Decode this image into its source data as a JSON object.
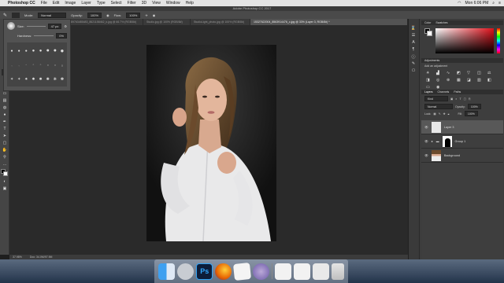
{
  "menubar": {
    "app_name": "Photoshop CC",
    "items": [
      "File",
      "Edit",
      "Image",
      "Layer",
      "Type",
      "Select",
      "Filter",
      "3D",
      "View",
      "Window",
      "Help"
    ],
    "clock": "Mon 6:06 PM"
  },
  "titlebar": {
    "title": "Adobe Photoshop CC 2017"
  },
  "options": {
    "mode_label": "Mode:",
    "mode_value": "Normal",
    "opacity_label": "Opacity:",
    "opacity_value": "100%",
    "flow_label": "Flow:",
    "flow_value": "100%"
  },
  "tabs": [
    {
      "label": "RGB/8#)"
    },
    {
      "label": "89763485483_8621158462_k.jpg @ 66.7% (RGB/8#)"
    },
    {
      "label": "Studio.jpg @ 100% (RGB/8#)"
    },
    {
      "label": "StudioLight_photo.jpg @ 100% (RGB/8#)"
    },
    {
      "label": "15327622004_8563914476_o.jpg @ 33% (Layer 3, RGB/8#) *",
      "active": true
    }
  ],
  "brush_panel": {
    "size_label": "Size:",
    "size_value": "47 px",
    "hardness_label": "Hardness:",
    "hardness_value": "0%"
  },
  "status": {
    "zoom": "37.98%",
    "doc": "Doc: 34.0M/97.9M"
  },
  "right_dock": {
    "color_tab": "Color",
    "swatches_tab": "Swatches",
    "adjustments_title": "Adjustments",
    "adjustments_sub": "Add an adjustment",
    "layers_tabs": [
      "Layers",
      "Channels",
      "Paths"
    ],
    "blend_mode": "Normal",
    "opacity_label": "Opacity:",
    "opacity_value": "100%",
    "lock_label": "Lock:",
    "fill_label": "Fill:",
    "fill_value": "100%",
    "kind_label": "Kind",
    "layers": [
      {
        "name": "Layer 3",
        "selected": true
      },
      {
        "name": "Group 1"
      },
      {
        "name": "Background"
      }
    ]
  },
  "colors": {
    "accent": "#2f66c9",
    "photoshop_icon": "#0d1d3a",
    "firefox": "#e66000"
  }
}
